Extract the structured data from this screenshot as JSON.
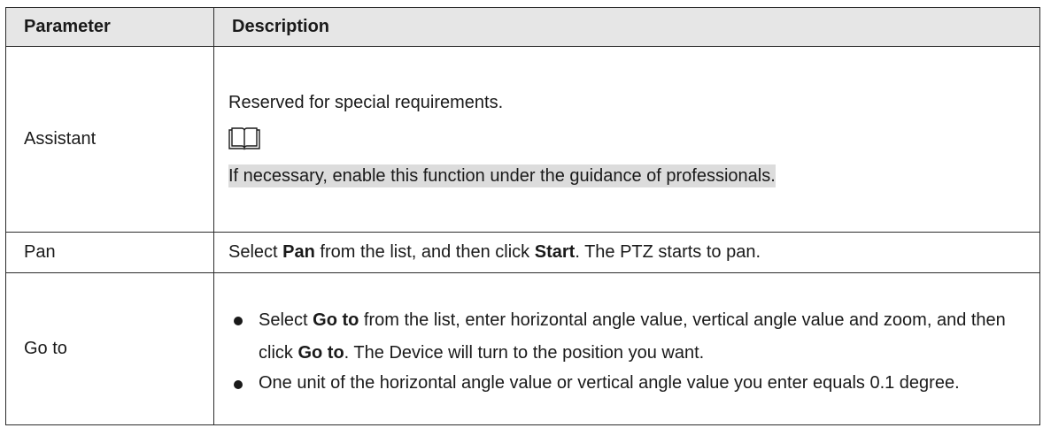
{
  "table": {
    "headers": {
      "parameter": "Parameter",
      "description": "Description"
    },
    "rows": {
      "assistant": {
        "parameter": "Assistant",
        "line1": "Reserved for special requirements.",
        "note_icon": "book-icon",
        "note": "If necessary, enable this function under the guidance of professionals."
      },
      "pan": {
        "parameter": "Pan",
        "t1": "Select ",
        "b1": "Pan",
        "t2": " from the list, and then click ",
        "b2": "Start",
        "t3": ". The PTZ starts to pan."
      },
      "goto": {
        "parameter": "Go to",
        "bullet1": {
          "t1": "Select ",
          "b1": "Go to",
          "t2": " from the list, enter horizontal angle value, vertical angle value and zoom, and then click ",
          "b2": "Go to",
          "t3": ". The Device will turn to the position you want."
        },
        "bullet2": "One unit of the horizontal angle value or vertical angle value you enter equals 0.1 degree."
      }
    }
  }
}
